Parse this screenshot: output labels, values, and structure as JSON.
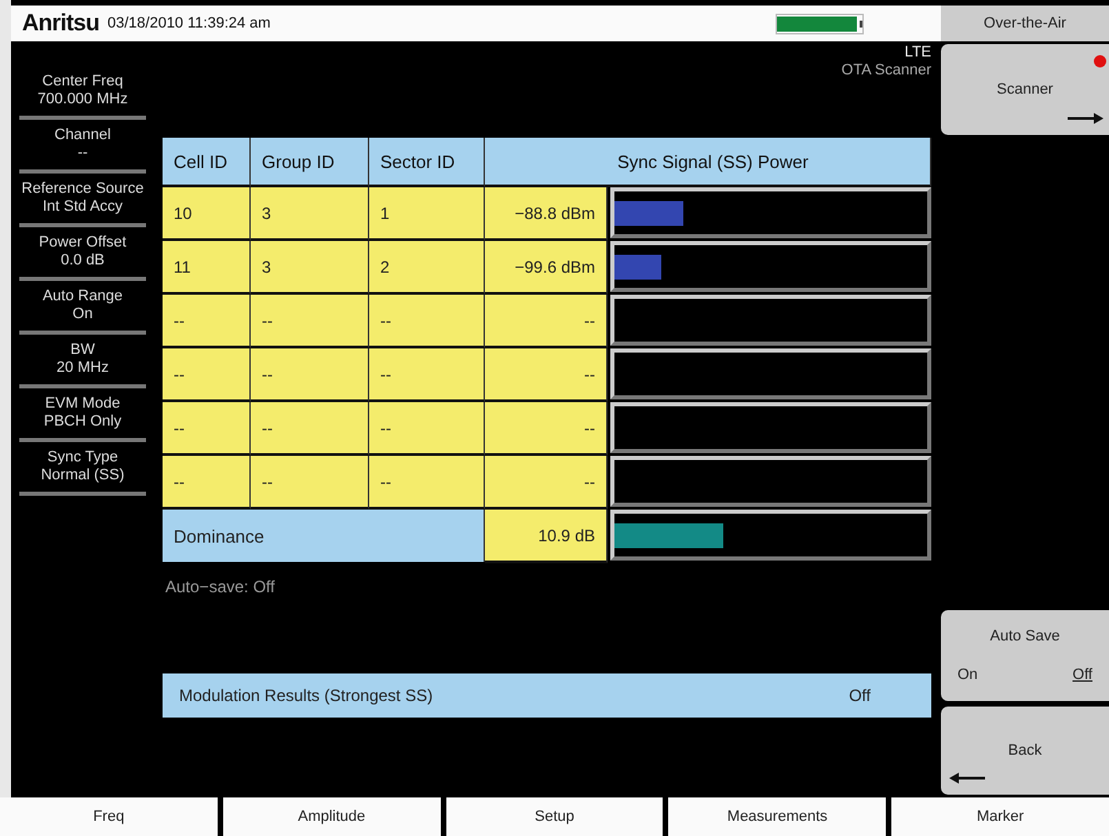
{
  "header": {
    "logo": "Anritsu",
    "datetime": "03/18/2010 11:39:24 am"
  },
  "mode": {
    "standard": "LTE",
    "measurement": "OTA Scanner"
  },
  "sidebar": [
    {
      "label": "Center Freq",
      "value": "700.000 MHz"
    },
    {
      "label": "Channel",
      "value": "--"
    },
    {
      "label": "Reference Source",
      "value": "Int Std Accy"
    },
    {
      "label": "Power Offset",
      "value": "0.0 dB"
    },
    {
      "label": "Auto Range",
      "value": "On"
    },
    {
      "label": "BW",
      "value": "20 MHz"
    },
    {
      "label": "EVM Mode",
      "value": "PBCH Only"
    },
    {
      "label": "Sync Type",
      "value": "Normal (SS)"
    }
  ],
  "table": {
    "columns": [
      "Cell ID",
      "Group ID",
      "Sector ID",
      "Sync Signal (SS) Power"
    ],
    "rows": [
      {
        "cells": [
          "10",
          "3",
          "1",
          "−88.8 dBm"
        ],
        "level": 0.22
      },
      {
        "cells": [
          "11",
          "3",
          "2",
          "−99.6 dBm"
        ],
        "level": 0.15
      },
      {
        "cells": [
          "--",
          "--",
          "--",
          "--"
        ]
      },
      {
        "cells": [
          "--",
          "--",
          "--",
          "--"
        ]
      },
      {
        "cells": [
          "--",
          "--",
          "--",
          "--"
        ]
      },
      {
        "cells": [
          "--",
          "--",
          "--",
          "--"
        ]
      }
    ],
    "dominance": {
      "label": "Dominance",
      "value": "10.9 dB",
      "level": 0.35
    }
  },
  "auto_save_status": "Auto−save: Off",
  "modulation": {
    "label": "Modulation Results (Strongest SS)",
    "value": "Off"
  },
  "softkeys": {
    "title": "Over-the-Air",
    "scanner": "Scanner",
    "auto_save": {
      "label": "Auto Save",
      "options": [
        {
          "label": "On",
          "selected": false
        },
        {
          "label": "Off",
          "selected": true
        }
      ]
    },
    "back": "Back"
  },
  "bottom_tabs": [
    "Freq",
    "Amplitude",
    "Setup",
    "Measurements",
    "Marker"
  ]
}
